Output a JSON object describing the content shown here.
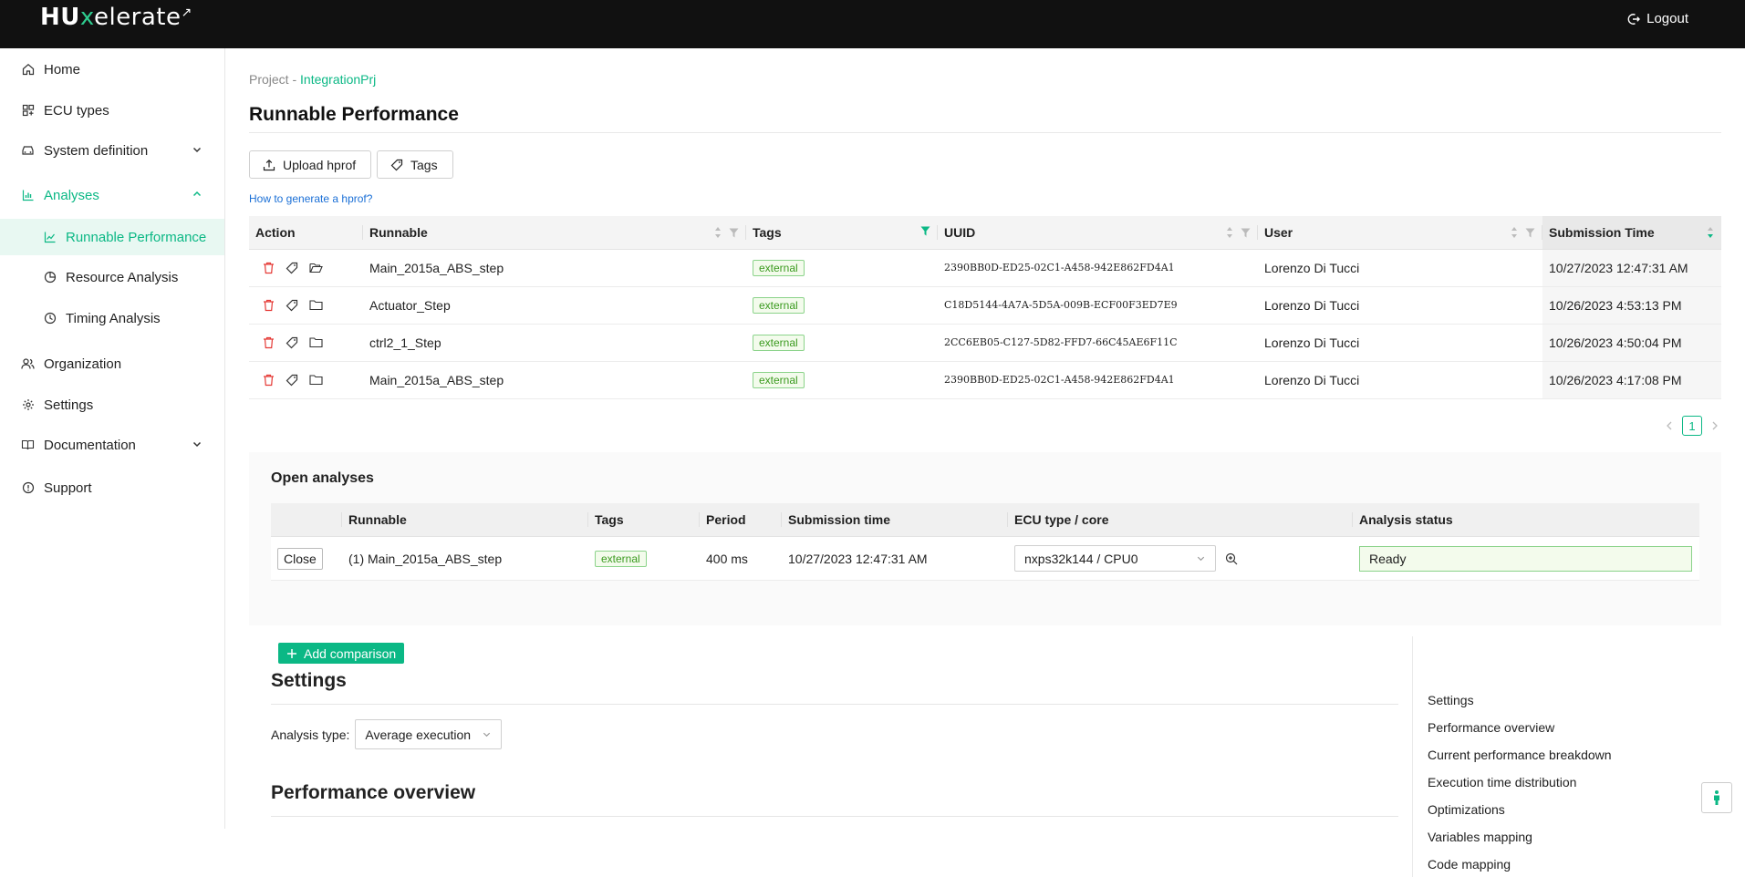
{
  "app": {
    "logo_hu": "HU",
    "logo_x": "x",
    "logo_rest": "elerate",
    "logout_label": "Logout"
  },
  "sidebar": {
    "items": [
      {
        "label": "Home",
        "icon": "home-icon"
      },
      {
        "label": "ECU types",
        "icon": "ecu-icon"
      },
      {
        "label": "System definition",
        "icon": "car-icon"
      },
      {
        "label": "Analyses",
        "icon": "chart-icon"
      },
      {
        "label": "Runnable Performance",
        "icon": "line-chart-icon"
      },
      {
        "label": "Resource Analysis",
        "icon": "pie-chart-icon"
      },
      {
        "label": "Timing Analysis",
        "icon": "clock-icon"
      },
      {
        "label": "Organization",
        "icon": "team-icon"
      },
      {
        "label": "Settings",
        "icon": "gear-icon"
      },
      {
        "label": "Documentation",
        "icon": "book-icon"
      },
      {
        "label": "Support",
        "icon": "info-icon"
      }
    ]
  },
  "breadcrumb": {
    "prefix": "Project - ",
    "project": "IntegrationPrj"
  },
  "page": {
    "title": "Runnable Performance",
    "upload_label": "Upload hprof",
    "tags_label": "Tags",
    "help_link": "How to generate a hprof?"
  },
  "runs_table": {
    "columns": [
      "Action",
      "Runnable",
      "Tags",
      "UUID",
      "User",
      "Submission Time"
    ],
    "rows": [
      {
        "runnable": "Main_2015a_ABS_step",
        "tag": "external",
        "uuid": "2390BB0D-ED25-02C1-A458-942E862FD4A1",
        "user": "Lorenzo Di Tucci",
        "time": "10/27/2023 12:47:31 AM"
      },
      {
        "runnable": "Actuator_Step",
        "tag": "external",
        "uuid": "C18D5144-4A7A-5D5A-009B-ECF00F3ED7E9",
        "user": "Lorenzo Di Tucci",
        "time": "10/26/2023 4:53:13 PM"
      },
      {
        "runnable": "ctrl2_1_Step",
        "tag": "external",
        "uuid": "2CC6EB05-C127-5D82-FFD7-66C45AE6F11C",
        "user": "Lorenzo Di Tucci",
        "time": "10/26/2023 4:50:04 PM"
      },
      {
        "runnable": "Main_2015a_ABS_step",
        "tag": "external",
        "uuid": "2390BB0D-ED25-02C1-A458-942E862FD4A1",
        "user": "Lorenzo Di Tucci",
        "time": "10/26/2023 4:17:08 PM"
      }
    ]
  },
  "pagination": {
    "current": "1"
  },
  "open_analyses": {
    "title": "Open analyses",
    "columns": [
      "Runnable",
      "Tags",
      "Period",
      "Submission time",
      "ECU type / core",
      "Analysis status"
    ],
    "row": {
      "close_label": "Close",
      "runnable": "(1) Main_2015a_ABS_step",
      "tag": "external",
      "period": "400 ms",
      "time": "10/27/2023 12:47:31 AM",
      "ecu": "nxps32k144 / CPU0",
      "status": "Ready"
    },
    "add_label": "Add comparison"
  },
  "settings_section": {
    "title": "Settings",
    "analysis_type_label": "Analysis type:",
    "analysis_type_value": "Average execution"
  },
  "performance_section": {
    "title": "Performance overview"
  },
  "toc": {
    "items": [
      "Settings",
      "Performance overview",
      "Current performance breakdown",
      "Execution time distribution",
      "Optimizations",
      "Variables mapping",
      "Code mapping"
    ]
  },
  "colors": {
    "accent": "#0bb885",
    "topbar": "#111111",
    "tag_border": "#8bd38a",
    "delete": "#e53935"
  }
}
